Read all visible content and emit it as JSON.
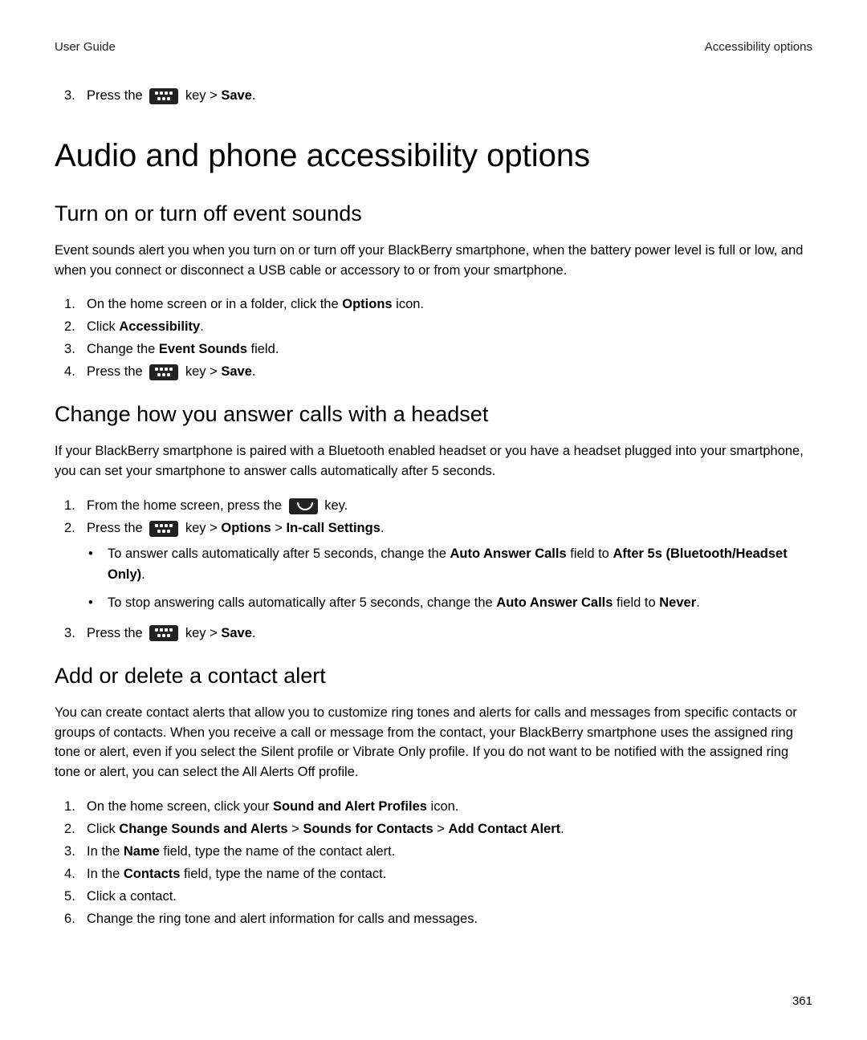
{
  "header": {
    "left": "User Guide",
    "right": "Accessibility options"
  },
  "orphan_step": {
    "num": "3.",
    "pre": "Press the ",
    "post_key": " key > ",
    "bold": "Save",
    "tail": "."
  },
  "h1": "Audio and phone accessibility options",
  "sec1": {
    "title": "Turn on or turn off event sounds",
    "para": "Event sounds alert you when you turn on or turn off your BlackBerry smartphone, when the battery power level is full or low, and when you connect or disconnect a USB cable or accessory to or from your smartphone.",
    "steps": {
      "s1_pre": "On the home screen or in a folder, click the ",
      "s1_bold": "Options",
      "s1_post": " icon.",
      "s2_pre": "Click ",
      "s2_bold": "Accessibility",
      "s2_post": ".",
      "s3_pre": "Change the ",
      "s3_bold": "Event Sounds",
      "s3_post": " field.",
      "s4_pre": "Press the ",
      "s4_mid": " key > ",
      "s4_bold": "Save",
      "s4_post": "."
    }
  },
  "sec2": {
    "title": "Change how you answer calls with a headset",
    "para": "If your BlackBerry smartphone is paired with a Bluetooth enabled headset or you have a headset plugged into your smartphone, you can set your smartphone to answer calls automatically after 5 seconds.",
    "steps": {
      "s1_pre": "From the home screen, press the ",
      "s1_post": " key.",
      "s2_pre": "Press the ",
      "s2_mid": " key > ",
      "s2_b1": "Options",
      "s2_sep": " > ",
      "s2_b2": "In-call Settings",
      "s2_post": ".",
      "b1_pre": "To answer calls automatically after 5 seconds, change the ",
      "b1_bold1": "Auto Answer Calls",
      "b1_mid": " field to ",
      "b1_bold2": "After 5s (Bluetooth/Headset Only)",
      "b1_post": ".",
      "b2_pre": "To stop answering calls automatically after 5 seconds, change the ",
      "b2_bold1": "Auto Answer Calls",
      "b2_mid": " field to ",
      "b2_bold2": "Never",
      "b2_post": ".",
      "s3_pre": "Press the ",
      "s3_mid": " key > ",
      "s3_bold": "Save",
      "s3_post": "."
    }
  },
  "sec3": {
    "title": "Add or delete a contact alert",
    "para": "You can create contact alerts that allow you to customize ring tones and alerts for calls and messages from specific contacts or groups of contacts. When you receive a call or message from the contact, your BlackBerry smartphone uses the assigned ring tone or alert, even if you select the Silent profile or Vibrate Only profile. If you do not want to be notified with the assigned ring tone or alert, you can select the All Alerts Off profile.",
    "steps": {
      "s1_pre": "On the home screen, click your ",
      "s1_bold": "Sound and Alert Profiles",
      "s1_post": " icon.",
      "s2_pre": "Click ",
      "s2_b1": "Change Sounds and Alerts",
      "s2_sep": " > ",
      "s2_b2": "Sounds for Contacts",
      "s2_b3": "Add Contact Alert",
      "s2_post": ".",
      "s3_pre": "In the ",
      "s3_bold": "Name",
      "s3_post": " field, type the name of the contact alert.",
      "s4_pre": "In the ",
      "s4_bold": "Contacts",
      "s4_post": " field, type the name of the contact.",
      "s5": "Click a contact.",
      "s6": "Change the ring tone and alert information for calls and messages."
    }
  },
  "page_num": "361"
}
